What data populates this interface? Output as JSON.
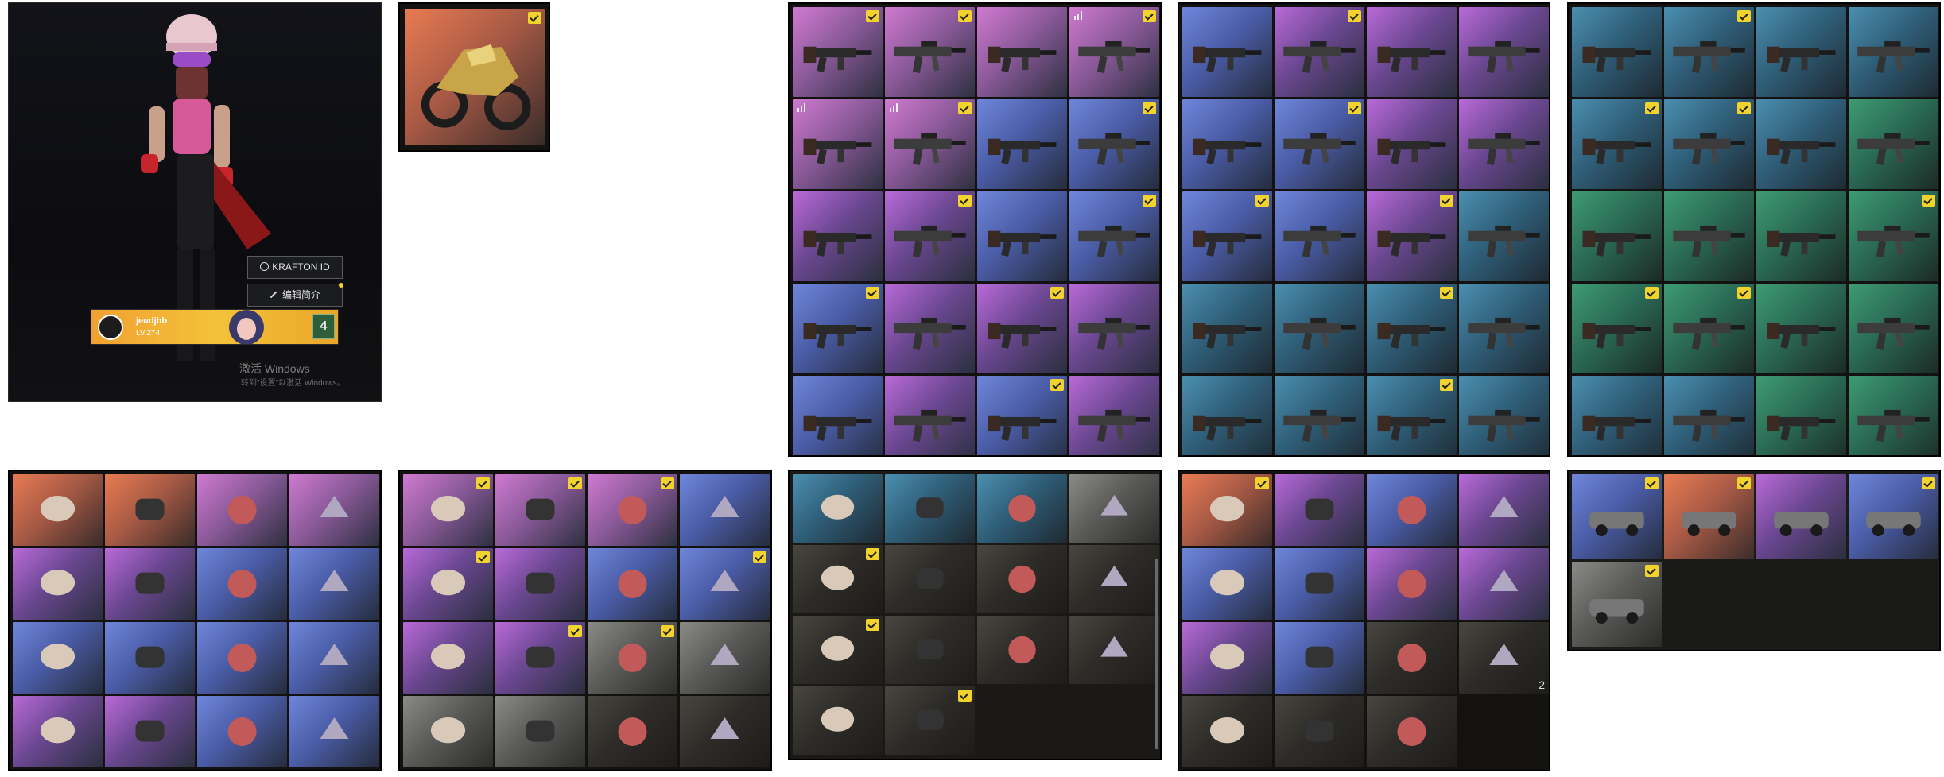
{
  "colors": {
    "check": "#f2d22c",
    "panel": "#141210",
    "page": "#ffffff"
  },
  "profile": {
    "krafton_button": "KRAFTON ID",
    "edit_intro_button": "编辑简介",
    "player_name": "jeudjbb",
    "player_level_text": "LV.274",
    "level_badge": "4",
    "windows_title": "激活 Windows",
    "windows_sub": "转到\"设置\"以激活 Windows。"
  },
  "vehicle_single": {
    "checked": true
  },
  "guns_1": [
    {
      "rarity": "pink",
      "checked": true
    },
    {
      "rarity": "pink",
      "checked": true
    },
    {
      "rarity": "pink",
      "checked": false
    },
    {
      "rarity": "pink",
      "checked": true,
      "signal": true
    },
    {
      "rarity": "pink",
      "checked": false,
      "signal": true
    },
    {
      "rarity": "pink",
      "checked": true,
      "signal": true
    },
    {
      "rarity": "blue",
      "checked": false
    },
    {
      "rarity": "blue",
      "checked": true
    },
    {
      "rarity": "purple",
      "checked": false
    },
    {
      "rarity": "purple",
      "checked": true
    },
    {
      "rarity": "blue",
      "checked": false
    },
    {
      "rarity": "blue",
      "checked": true
    },
    {
      "rarity": "blue",
      "checked": true
    },
    {
      "rarity": "purple",
      "checked": false
    },
    {
      "rarity": "purple",
      "checked": true
    },
    {
      "rarity": "purple",
      "checked": false
    },
    {
      "rarity": "blue",
      "checked": false
    },
    {
      "rarity": "purple",
      "checked": false
    },
    {
      "rarity": "blue",
      "checked": true
    },
    {
      "rarity": "purple",
      "checked": false
    }
  ],
  "guns_2": [
    {
      "rarity": "blue",
      "checked": false
    },
    {
      "rarity": "purple",
      "checked": true
    },
    {
      "rarity": "purple",
      "checked": false
    },
    {
      "rarity": "purple",
      "checked": false
    },
    {
      "rarity": "blue",
      "checked": false
    },
    {
      "rarity": "blue",
      "checked": true
    },
    {
      "rarity": "purple",
      "checked": false
    },
    {
      "rarity": "purple",
      "checked": false
    },
    {
      "rarity": "blue",
      "checked": true
    },
    {
      "rarity": "blue",
      "checked": false
    },
    {
      "rarity": "purple",
      "checked": true
    },
    {
      "rarity": "teal",
      "checked": false
    },
    {
      "rarity": "teal",
      "checked": false
    },
    {
      "rarity": "teal",
      "checked": false
    },
    {
      "rarity": "teal",
      "checked": true
    },
    {
      "rarity": "teal",
      "checked": false
    },
    {
      "rarity": "teal",
      "checked": false
    },
    {
      "rarity": "teal",
      "checked": false
    },
    {
      "rarity": "teal",
      "checked": true
    },
    {
      "rarity": "teal",
      "checked": false
    }
  ],
  "guns_3": [
    {
      "rarity": "teal",
      "checked": false
    },
    {
      "rarity": "teal",
      "checked": true
    },
    {
      "rarity": "teal",
      "checked": false
    },
    {
      "rarity": "teal",
      "checked": false
    },
    {
      "rarity": "teal",
      "checked": true
    },
    {
      "rarity": "teal",
      "checked": true
    },
    {
      "rarity": "teal",
      "checked": false
    },
    {
      "rarity": "green",
      "checked": false
    },
    {
      "rarity": "green",
      "checked": false
    },
    {
      "rarity": "green",
      "checked": false
    },
    {
      "rarity": "green",
      "checked": false
    },
    {
      "rarity": "green",
      "checked": true
    },
    {
      "rarity": "green",
      "checked": true
    },
    {
      "rarity": "green",
      "checked": true
    },
    {
      "rarity": "green",
      "checked": false
    },
    {
      "rarity": "green",
      "checked": false
    },
    {
      "rarity": "teal",
      "checked": false
    },
    {
      "rarity": "teal",
      "checked": false
    },
    {
      "rarity": "green",
      "checked": false
    },
    {
      "rarity": "green",
      "checked": false
    }
  ],
  "accessories": [
    {
      "rarity": "orange",
      "checked": false
    },
    {
      "rarity": "orange",
      "checked": false
    },
    {
      "rarity": "pink",
      "checked": false
    },
    {
      "rarity": "pink",
      "checked": false
    },
    {
      "rarity": "purple",
      "checked": false
    },
    {
      "rarity": "purple",
      "checked": false
    },
    {
      "rarity": "blue",
      "checked": false
    },
    {
      "rarity": "blue",
      "checked": false
    },
    {
      "rarity": "blue",
      "checked": false
    },
    {
      "rarity": "blue",
      "checked": false
    },
    {
      "rarity": "blue",
      "checked": false
    },
    {
      "rarity": "blue",
      "checked": false
    },
    {
      "rarity": "purple",
      "checked": false
    },
    {
      "rarity": "purple",
      "checked": false
    },
    {
      "rarity": "blue",
      "checked": false
    },
    {
      "rarity": "blue",
      "checked": false
    }
  ],
  "gear": [
    {
      "rarity": "pink",
      "checked": true
    },
    {
      "rarity": "pink",
      "checked": true
    },
    {
      "rarity": "pink",
      "checked": true
    },
    {
      "rarity": "blue",
      "checked": false
    },
    {
      "rarity": "purple",
      "checked": true
    },
    {
      "rarity": "purple",
      "checked": false
    },
    {
      "rarity": "blue",
      "checked": false
    },
    {
      "rarity": "blue",
      "checked": true
    },
    {
      "rarity": "purple",
      "checked": false
    },
    {
      "rarity": "purple",
      "checked": true
    },
    {
      "rarity": "gray",
      "checked": true
    },
    {
      "rarity": "gray",
      "checked": false
    },
    {
      "rarity": "gray",
      "checked": false
    },
    {
      "rarity": "gray",
      "checked": false
    },
    {
      "rarity": "dark",
      "checked": false
    },
    {
      "rarity": "dark",
      "checked": false
    }
  ],
  "headwear": [
    {
      "rarity": "teal",
      "checked": false
    },
    {
      "rarity": "teal",
      "checked": false
    },
    {
      "rarity": "teal",
      "checked": false
    },
    {
      "rarity": "gray",
      "checked": false
    },
    {
      "rarity": "dark",
      "checked": true
    },
    {
      "rarity": "dark",
      "checked": false
    },
    {
      "rarity": "dark",
      "checked": false
    },
    {
      "rarity": "dark",
      "checked": false
    },
    {
      "rarity": "dark",
      "checked": true
    },
    {
      "rarity": "dark",
      "checked": false
    },
    {
      "rarity": "dark",
      "checked": false
    },
    {
      "rarity": "dark",
      "checked": false
    },
    {
      "rarity": "dark",
      "checked": false
    },
    {
      "rarity": "dark",
      "checked": true
    }
  ],
  "clothing": [
    {
      "rarity": "orange",
      "checked": true
    },
    {
      "rarity": "purple",
      "checked": false
    },
    {
      "rarity": "blue",
      "checked": false
    },
    {
      "rarity": "purple",
      "checked": false
    },
    {
      "rarity": "blue",
      "checked": false
    },
    {
      "rarity": "blue",
      "checked": false
    },
    {
      "rarity": "purple",
      "checked": false
    },
    {
      "rarity": "purple",
      "checked": false
    },
    {
      "rarity": "purple",
      "checked": false
    },
    {
      "rarity": "blue",
      "checked": false
    },
    {
      "rarity": "dark",
      "checked": false
    },
    {
      "rarity": "dark",
      "checked": false,
      "count": "2"
    },
    {
      "rarity": "dark",
      "checked": false
    },
    {
      "rarity": "dark",
      "checked": false
    },
    {
      "rarity": "dark",
      "checked": false
    }
  ],
  "vehicles": [
    {
      "rarity": "blue",
      "checked": true
    },
    {
      "rarity": "orange",
      "checked": true
    },
    {
      "rarity": "purple",
      "checked": false
    },
    {
      "rarity": "blue",
      "checked": true
    },
    {
      "rarity": "gray",
      "checked": true
    }
  ]
}
